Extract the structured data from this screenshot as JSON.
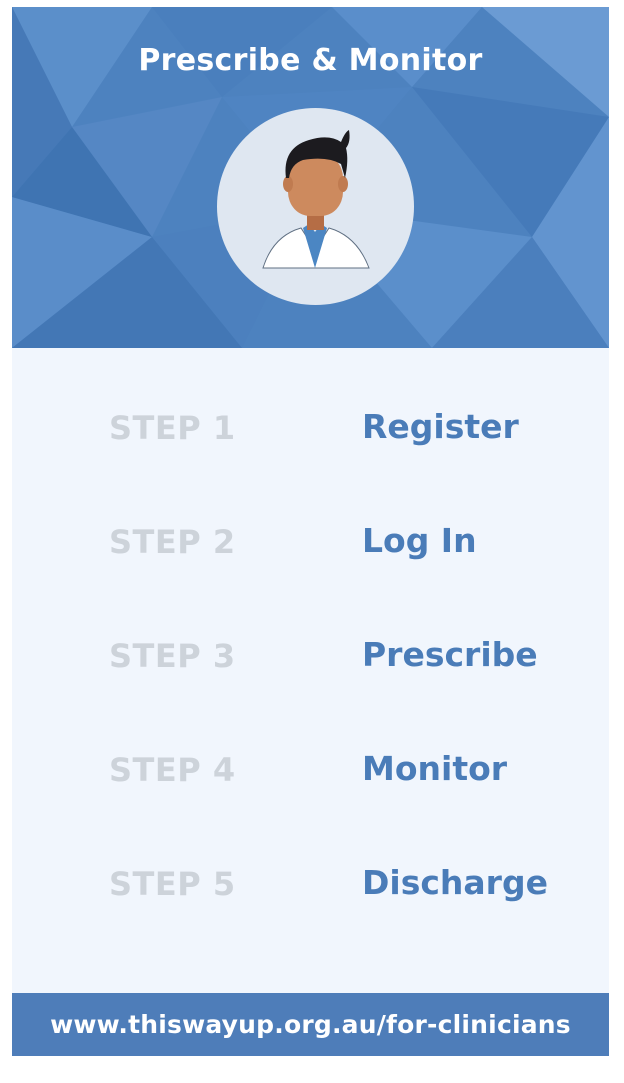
{
  "header": {
    "title": "Prescribe & Monitor",
    "avatar_icon": "doctor-avatar-icon"
  },
  "steps": [
    {
      "number": "STEP 1",
      "label": "Register"
    },
    {
      "number": "STEP 2",
      "label": "Log In"
    },
    {
      "number": "STEP 3",
      "label": "Prescribe"
    },
    {
      "number": "STEP 4",
      "label": "Monitor"
    },
    {
      "number": "STEP 5",
      "label": "Discharge"
    }
  ],
  "footer": {
    "url": "www.thiswayup.org.au/for-clinicians"
  },
  "colors": {
    "header_bg": "#4d82bf",
    "body_bg": "#f1f6fd",
    "step_number": "#cdd3da",
    "step_label": "#4a7cb8",
    "footer_bg": "#4e7db9"
  }
}
